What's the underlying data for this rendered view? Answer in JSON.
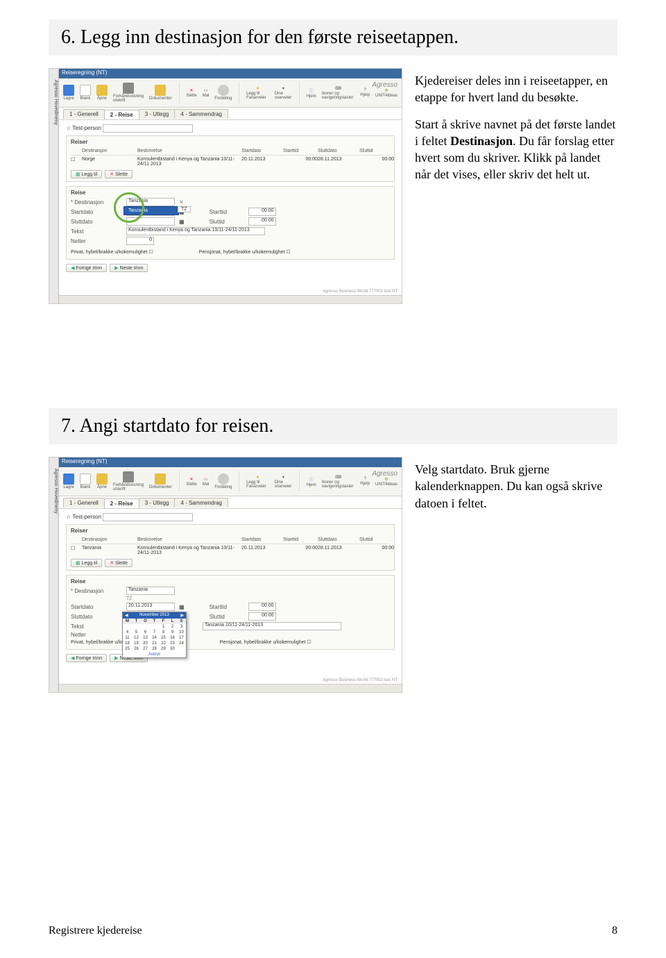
{
  "section6": {
    "heading": "6. Legg inn destinasjon for den første reiseetappen.",
    "para1": "Kjedereiser deles inn i reiseetapper, en etappe for hvert land du besøkte.",
    "para2a": "Start å skrive navnet på det første landet i feltet ",
    "para2b": "Destinasjon",
    "para2c": ". Du får forslag etter hvert som du skriver. Klikk på landet når det vises, eller skriv det helt ut."
  },
  "section7": {
    "heading": "7. Angi startdato for reisen.",
    "para1": "Velg startdato. Bruk gjerne kalenderknappen. Du kan også skrive datoen i feltet."
  },
  "app": {
    "sidemenu": "Agresso Hovedmeny",
    "title": "Reiseregning (NT)",
    "logo": "Agresso",
    "ribbon": {
      "lagre": "Lagre",
      "blank": "Blank",
      "apne": "Åpne",
      "forhand": "Forhåndsvisning utskrift",
      "dokumenter": "Dokumenter",
      "slette": "Slette",
      "mal": "Mal",
      "fordeling": "Fordeling",
      "leggtil": "Legg til Fanarveler",
      "snarveier": "Dine snarveier",
      "hjem": "Hjem",
      "ikoner": "Ikoner og navigeringstaster",
      "hjelp": "Hjelp",
      "unit4": "UNIT4Ideas"
    },
    "tabs": [
      "1 - Generell",
      "2 - Reise",
      "3 - Utlegg",
      "4 - Sammendrag"
    ],
    "testperson": "Test-person",
    "reiser_label": "Reiser",
    "cols": {
      "dest": "Destinasjon",
      "beskr": "Beskrivelse",
      "startdato": "Startdato",
      "starttid": "Starttid",
      "sluttdato": "Sluttdato",
      "sluttid": "Sluttid"
    },
    "row1": {
      "dest": "Norge",
      "beskr": "Konsulentbistand i Kenya og Tanzania 10/11-24/11 2013",
      "startdato": "20.11.2013",
      "starttid": "00:00",
      "sluttdato": "28.11.2013",
      "sluttid": "00:00"
    },
    "row2": {
      "dest": "Tanzania",
      "beskr": "Konsulentbistand i Kenya og Tanzania 10/11-24/11-2013",
      "startdato": "20.11.2013",
      "starttid": "00:00",
      "sluttdato": "28.11.2013",
      "sluttid": "00:00"
    },
    "btn_leggtil": "Legg til",
    "btn_slette": "Slette",
    "reise_label": "Reise",
    "form": {
      "dest": "* Destinasjon",
      "startdato": "Startdato",
      "starttid": "Starttid",
      "sluttdato": "Sluttdato",
      "sluttid": "Sluttid",
      "tekst": "Tekst",
      "netter": "Netter",
      "privat": "Privat, hybel/brakke u/kokemulighet",
      "pensjonat": "Pensjonat, hybel/brakke u/kokemulighet"
    },
    "form_vals1": {
      "dest": "Tanzania",
      "sugg": "Tanzania",
      "tz": "TZ",
      "starttid": "00:00",
      "sluttid": "00:00",
      "tekst": "Konsulentbistand i Kenya og Tanzania 10/11-24/11-2013",
      "netter": "0"
    },
    "form_vals2": {
      "dest": "Tanzania",
      "tz": "TZ",
      "startdato": "20.11.2013",
      "starttid": "00:00",
      "sluttid": "00:00",
      "tekst": "Tanzania 10/11-24/11-2013"
    },
    "cal": {
      "month": "November",
      "year": "2013",
      "dow": [
        "M",
        "T",
        "O",
        "T",
        "F",
        "L",
        "S"
      ],
      "weeks": [
        [
          "",
          "",
          "",
          "",
          "1",
          "2",
          "3"
        ],
        [
          "4",
          "5",
          "6",
          "7",
          "8",
          "9",
          "10"
        ],
        [
          "11",
          "12",
          "13",
          "14",
          "15",
          "16",
          "17"
        ],
        [
          "18",
          "19",
          "20",
          "21",
          "22",
          "23",
          "24"
        ],
        [
          "25",
          "26",
          "27",
          "28",
          "29",
          "30",
          ""
        ]
      ],
      "avbryt": "Avbryt"
    },
    "nav_prev": "Forrige trinn",
    "nav_next": "Neste trinn",
    "footerline": "Agresso Business World  777002  test  NT"
  },
  "footer": {
    "left": "Registrere kjedereise",
    "right": "8"
  }
}
